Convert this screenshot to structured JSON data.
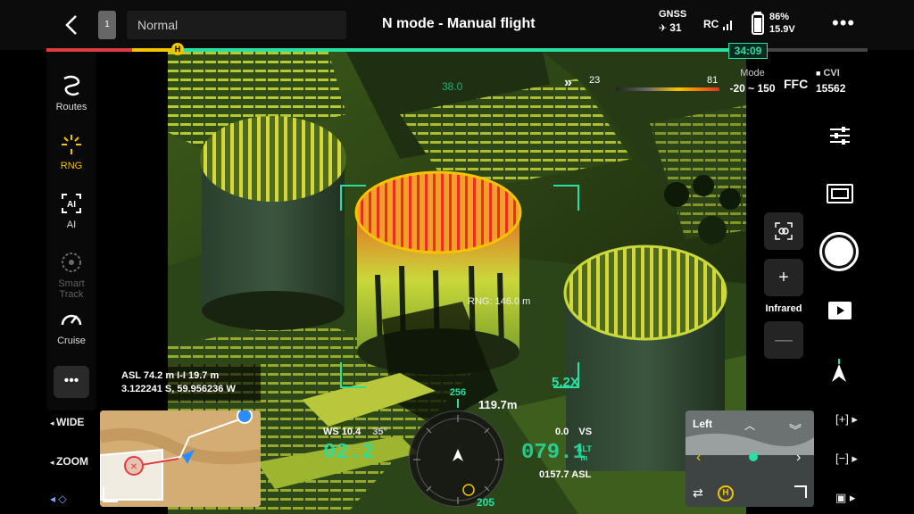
{
  "topbar": {
    "mode_select": "Normal",
    "title": "N mode - Manual flight",
    "gnss_label": "GNSS",
    "gnss_count": "31",
    "rc_label": "RC",
    "battery_percent": "86%",
    "battery_voltage": "15.9V",
    "flight_time": "34:09"
  },
  "left_toolbar": {
    "items": [
      {
        "label": "Routes"
      },
      {
        "label": "RNG"
      },
      {
        "label": "AI"
      },
      {
        "label": "Smart Track"
      },
      {
        "label": "Cruise"
      }
    ]
  },
  "thermal": {
    "scale_min": "23",
    "scale_max": "81",
    "mode_label": "Mode",
    "range": "-20 ~ 150",
    "ffc": "FFC",
    "cvi_label": "CVI",
    "cvi_value": "15562",
    "cursor_temp": "38.0"
  },
  "overlay": {
    "rng_label": "RNG: 146.0 m",
    "zoom_factor": "5.2X",
    "asl_line": "ASL 74.2 m  I-I  19.7 m",
    "coords": "3.122241 S, 59.956236 W",
    "heading": "256",
    "distance": "119.7m",
    "ws": "WS 10.4",
    "ws_dir": "35°",
    "hs_value": "02.2",
    "vs_value": "0.0",
    "vs_label": "VS",
    "alt_value": "079.1",
    "alt_label": "ALT",
    "alt_unit": "m",
    "asl_small": "0157.7 ASL",
    "bottom_heading": "205"
  },
  "left_controls": {
    "wide": "WIDE",
    "zoom": "ZOOM"
  },
  "right_controls": {
    "camera_label": "Infrared"
  },
  "pip": {
    "label": "Left"
  },
  "colors": {
    "accent_green": "#27e0a3",
    "hot": "#ff5a1a",
    "warn": "#f5c400"
  }
}
